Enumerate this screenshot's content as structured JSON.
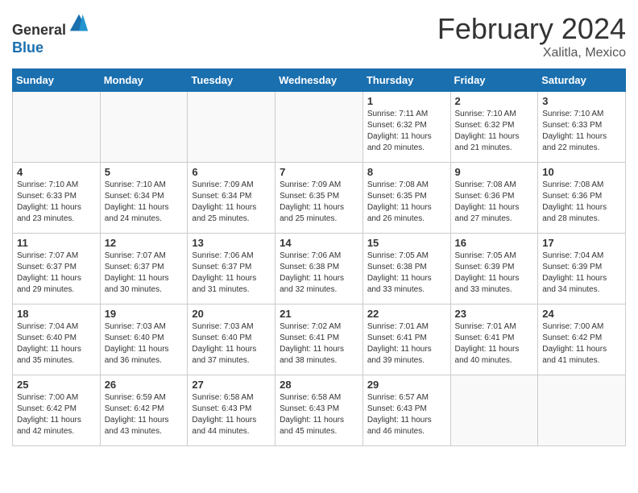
{
  "header": {
    "logo_line1": "General",
    "logo_line2": "Blue",
    "month_title": "February 2024",
    "location": "Xalitla, Mexico"
  },
  "days_of_week": [
    "Sunday",
    "Monday",
    "Tuesday",
    "Wednesday",
    "Thursday",
    "Friday",
    "Saturday"
  ],
  "weeks": [
    [
      {
        "day": "",
        "info": ""
      },
      {
        "day": "",
        "info": ""
      },
      {
        "day": "",
        "info": ""
      },
      {
        "day": "",
        "info": ""
      },
      {
        "day": "1",
        "info": "Sunrise: 7:11 AM\nSunset: 6:32 PM\nDaylight: 11 hours\nand 20 minutes."
      },
      {
        "day": "2",
        "info": "Sunrise: 7:10 AM\nSunset: 6:32 PM\nDaylight: 11 hours\nand 21 minutes."
      },
      {
        "day": "3",
        "info": "Sunrise: 7:10 AM\nSunset: 6:33 PM\nDaylight: 11 hours\nand 22 minutes."
      }
    ],
    [
      {
        "day": "4",
        "info": "Sunrise: 7:10 AM\nSunset: 6:33 PM\nDaylight: 11 hours\nand 23 minutes."
      },
      {
        "day": "5",
        "info": "Sunrise: 7:10 AM\nSunset: 6:34 PM\nDaylight: 11 hours\nand 24 minutes."
      },
      {
        "day": "6",
        "info": "Sunrise: 7:09 AM\nSunset: 6:34 PM\nDaylight: 11 hours\nand 25 minutes."
      },
      {
        "day": "7",
        "info": "Sunrise: 7:09 AM\nSunset: 6:35 PM\nDaylight: 11 hours\nand 25 minutes."
      },
      {
        "day": "8",
        "info": "Sunrise: 7:08 AM\nSunset: 6:35 PM\nDaylight: 11 hours\nand 26 minutes."
      },
      {
        "day": "9",
        "info": "Sunrise: 7:08 AM\nSunset: 6:36 PM\nDaylight: 11 hours\nand 27 minutes."
      },
      {
        "day": "10",
        "info": "Sunrise: 7:08 AM\nSunset: 6:36 PM\nDaylight: 11 hours\nand 28 minutes."
      }
    ],
    [
      {
        "day": "11",
        "info": "Sunrise: 7:07 AM\nSunset: 6:37 PM\nDaylight: 11 hours\nand 29 minutes."
      },
      {
        "day": "12",
        "info": "Sunrise: 7:07 AM\nSunset: 6:37 PM\nDaylight: 11 hours\nand 30 minutes."
      },
      {
        "day": "13",
        "info": "Sunrise: 7:06 AM\nSunset: 6:37 PM\nDaylight: 11 hours\nand 31 minutes."
      },
      {
        "day": "14",
        "info": "Sunrise: 7:06 AM\nSunset: 6:38 PM\nDaylight: 11 hours\nand 32 minutes."
      },
      {
        "day": "15",
        "info": "Sunrise: 7:05 AM\nSunset: 6:38 PM\nDaylight: 11 hours\nand 33 minutes."
      },
      {
        "day": "16",
        "info": "Sunrise: 7:05 AM\nSunset: 6:39 PM\nDaylight: 11 hours\nand 33 minutes."
      },
      {
        "day": "17",
        "info": "Sunrise: 7:04 AM\nSunset: 6:39 PM\nDaylight: 11 hours\nand 34 minutes."
      }
    ],
    [
      {
        "day": "18",
        "info": "Sunrise: 7:04 AM\nSunset: 6:40 PM\nDaylight: 11 hours\nand 35 minutes."
      },
      {
        "day": "19",
        "info": "Sunrise: 7:03 AM\nSunset: 6:40 PM\nDaylight: 11 hours\nand 36 minutes."
      },
      {
        "day": "20",
        "info": "Sunrise: 7:03 AM\nSunset: 6:40 PM\nDaylight: 11 hours\nand 37 minutes."
      },
      {
        "day": "21",
        "info": "Sunrise: 7:02 AM\nSunset: 6:41 PM\nDaylight: 11 hours\nand 38 minutes."
      },
      {
        "day": "22",
        "info": "Sunrise: 7:01 AM\nSunset: 6:41 PM\nDaylight: 11 hours\nand 39 minutes."
      },
      {
        "day": "23",
        "info": "Sunrise: 7:01 AM\nSunset: 6:41 PM\nDaylight: 11 hours\nand 40 minutes."
      },
      {
        "day": "24",
        "info": "Sunrise: 7:00 AM\nSunset: 6:42 PM\nDaylight: 11 hours\nand 41 minutes."
      }
    ],
    [
      {
        "day": "25",
        "info": "Sunrise: 7:00 AM\nSunset: 6:42 PM\nDaylight: 11 hours\nand 42 minutes."
      },
      {
        "day": "26",
        "info": "Sunrise: 6:59 AM\nSunset: 6:42 PM\nDaylight: 11 hours\nand 43 minutes."
      },
      {
        "day": "27",
        "info": "Sunrise: 6:58 AM\nSunset: 6:43 PM\nDaylight: 11 hours\nand 44 minutes."
      },
      {
        "day": "28",
        "info": "Sunrise: 6:58 AM\nSunset: 6:43 PM\nDaylight: 11 hours\nand 45 minutes."
      },
      {
        "day": "29",
        "info": "Sunrise: 6:57 AM\nSunset: 6:43 PM\nDaylight: 11 hours\nand 46 minutes."
      },
      {
        "day": "",
        "info": ""
      },
      {
        "day": "",
        "info": ""
      }
    ]
  ]
}
